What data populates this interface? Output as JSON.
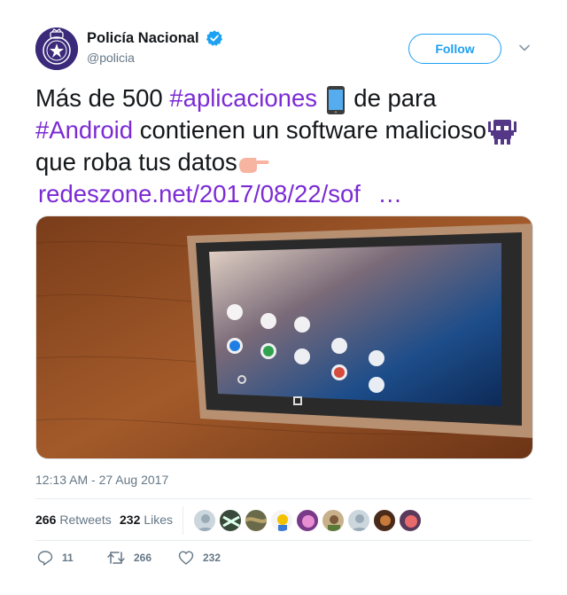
{
  "author": {
    "display_name": "Policía Nacional",
    "handle": "@policia",
    "avatar_icon": "police-badge-icon",
    "verified": true
  },
  "follow_label": "Follow",
  "tweet": {
    "line1": {
      "pre": "Más de 500 ",
      "hashtag": "#aplicaciones",
      "emoji": "mobile-phone",
      "post": " de para"
    },
    "line2": {
      "hashtag": "#Android",
      "post": " contienen un software malicioso",
      "emoji": "alien-monster"
    },
    "line3": {
      "pre": "que roba tus datos",
      "emoji": "pointing-hand"
    },
    "link": "redeszone.net/2017/08/22/sof",
    "link_ellipsis": "…"
  },
  "media": {
    "description_icon": "android-phone-photo"
  },
  "timestamp": "12:13 AM - 27 Aug 2017",
  "stats": {
    "retweets_count": "266",
    "retweets_label": "Retweets",
    "likes_count": "232",
    "likes_label": "Likes"
  },
  "actions": {
    "reply_count": "11",
    "retweet_count": "266",
    "like_count": "232"
  },
  "colors": {
    "accent": "#1da1f2",
    "hashtag": "#7b2bd4",
    "muted": "#657786"
  }
}
